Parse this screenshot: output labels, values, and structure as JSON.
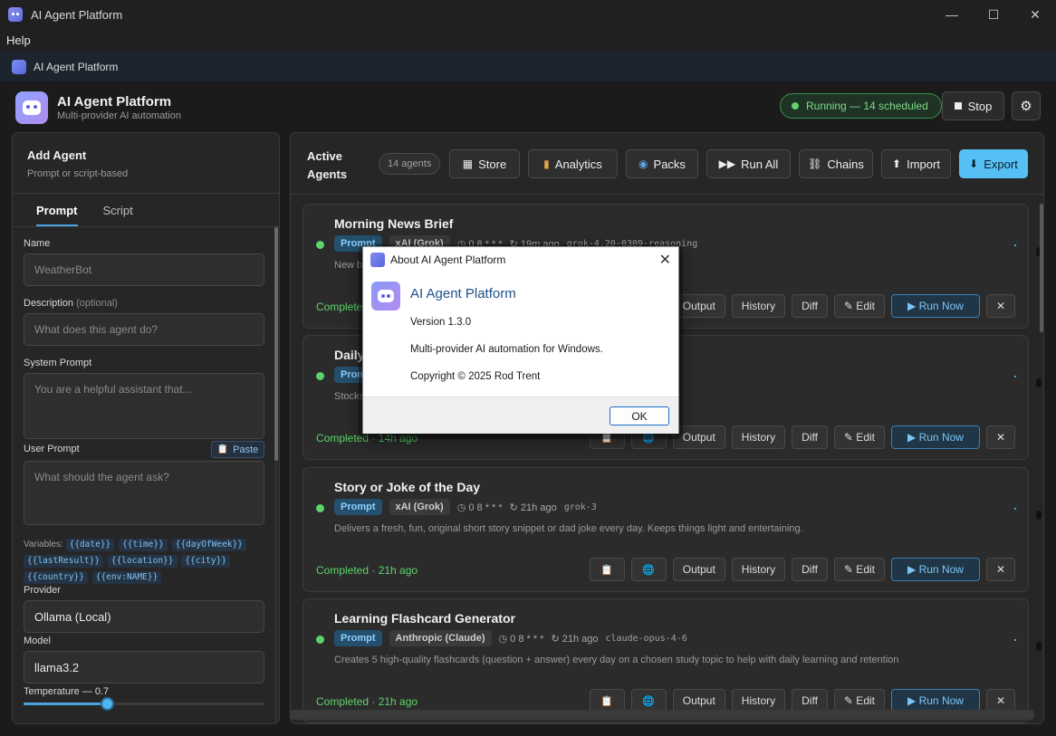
{
  "window": {
    "title": "AI Agent Platform",
    "minimize": "—",
    "maximize": "☐",
    "close": "✕"
  },
  "menu": {
    "help": "Help"
  },
  "tab": {
    "title": "AI Agent Platform"
  },
  "header": {
    "title": "AI Agent Platform",
    "subtitle": "Multi-provider AI automation",
    "status": "Running — 14 scheduled",
    "stop": "Stop",
    "settings_icon": "⚙"
  },
  "add_agent": {
    "title": "Add Agent",
    "subtitle": "Prompt or script-based",
    "tabs": [
      "Prompt",
      "Script"
    ],
    "name_label": "Name",
    "name_placeholder": "WeatherBot",
    "desc_label": "Description",
    "desc_optional": "(optional)",
    "desc_placeholder": "What does this agent do?",
    "system_label": "System Prompt",
    "system_placeholder": "You are a helpful assistant that...",
    "user_label": "User Prompt",
    "paste": "Paste",
    "user_placeholder": "What should the agent ask?",
    "variables_label": "Variables:",
    "variables": [
      "{{date}}",
      "{{time}}",
      "{{dayOfWeek}}",
      "{{lastResult}}",
      "{{location}}",
      "{{city}}",
      "{{country}}",
      "{{env:NAME}}"
    ],
    "provider_label": "Provider",
    "provider_value": "Ollama (Local)",
    "model_label": "Model",
    "model_value": "llama3.2",
    "temperature_label": "Temperature — 0.7",
    "temperature": 0.7
  },
  "active": {
    "title": "Active Agents",
    "count": "14 agents",
    "toolbar": [
      {
        "icon": "▦",
        "label": "Store"
      },
      {
        "icon": "▮",
        "label": "Analytics"
      },
      {
        "icon": "◉",
        "label": "Packs"
      },
      {
        "icon": "▶▶",
        "label": "Run All"
      },
      {
        "icon": "⛓",
        "label": "Chains"
      },
      {
        "icon": "⬆",
        "label": "Import"
      },
      {
        "icon": "⬇",
        "label": "Export"
      }
    ],
    "agents": [
      {
        "name": "Morning News Brief",
        "type": "Prompt",
        "provider": "xAI (Grok)",
        "schedule": "◷ 0 8 * * *",
        "last": "↻ 19m ago",
        "model": "grok-4.20-0309-reasoning",
        "desc": "New b",
        "status": "Completed"
      },
      {
        "name": "Daily",
        "type": "Prom",
        "provider": "",
        "schedule": "",
        "last": "",
        "model": "",
        "desc": "Stocks",
        "status": "Completed · 14h ago"
      },
      {
        "name": "Story or Joke of the Day",
        "type": "Prompt",
        "provider": "xAI (Grok)",
        "schedule": "◷ 0 8 * * *",
        "last": "↻ 21h ago",
        "model": "grok-3",
        "desc": "Delivers a fresh, fun, original short story snippet or dad joke every day. Keeps things light and entertaining.",
        "status": "Completed · 21h ago"
      },
      {
        "name": "Learning Flashcard Generator",
        "type": "Prompt",
        "provider": "Anthropic (Claude)",
        "schedule": "◷ 0 8 * * *",
        "last": "↻ 21h ago",
        "model": "claude-opus-4-6",
        "desc": "Creates 5 high-quality flashcards (question + answer) every day on a chosen study topic to help with daily learning and retention",
        "status": "Completed · 21h ago"
      }
    ],
    "card_buttons": {
      "notes_icon": "📋",
      "web_icon": "🌐",
      "output": "Output",
      "history": "History",
      "diff": "Diff",
      "edit": "✎ Edit",
      "run": "▶ Run Now",
      "remove": "✕"
    }
  },
  "about": {
    "title": "About AI Agent Platform",
    "close": "✕",
    "app": "AI Agent Platform",
    "version": "Version 1.3.0",
    "description": "Multi-provider AI automation for Windows.",
    "copyright": "Copyright © 2025 Rod Trent",
    "ok": "OK"
  }
}
